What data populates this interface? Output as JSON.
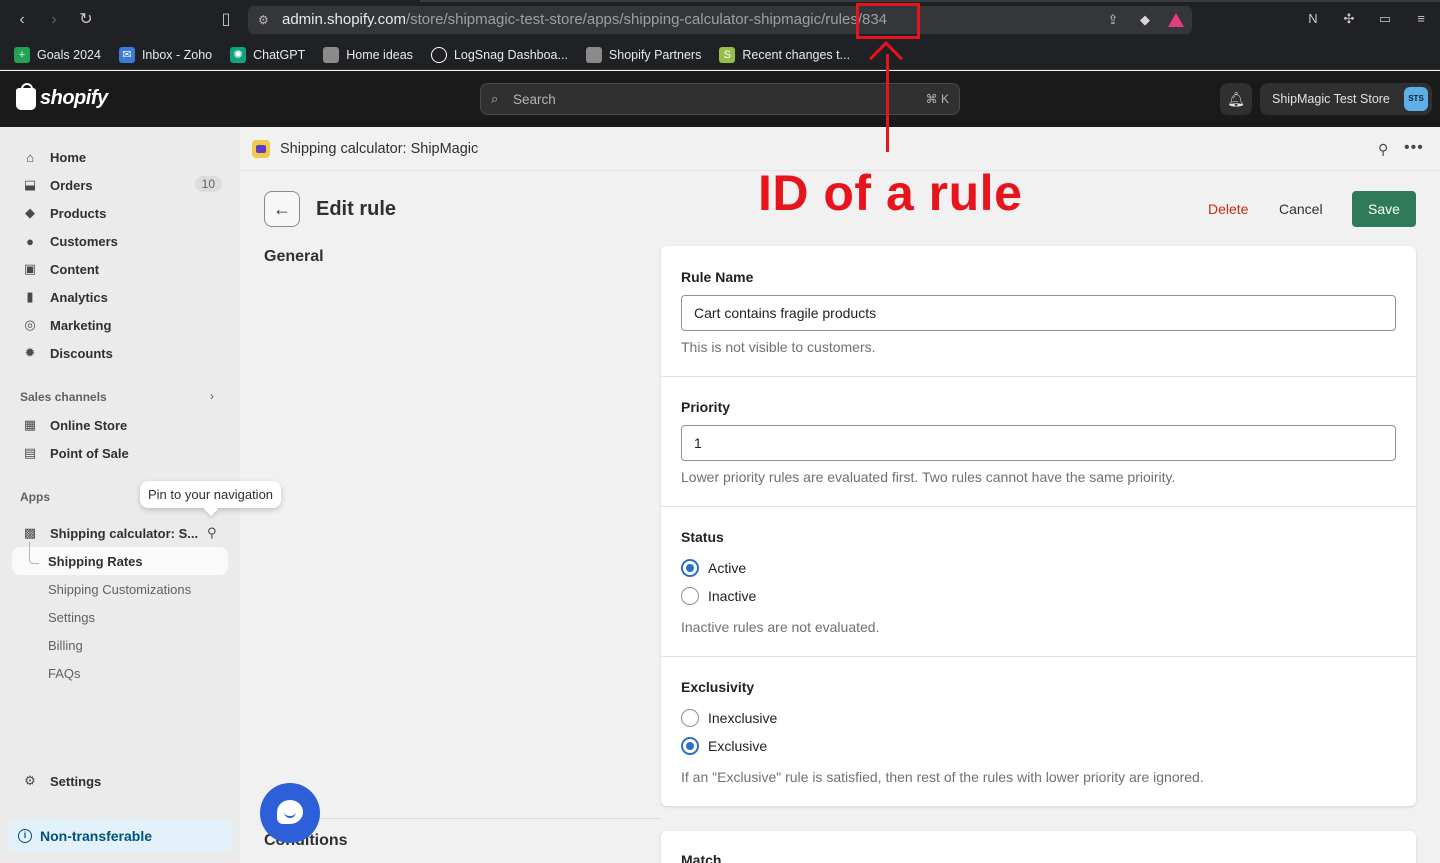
{
  "browser": {
    "url_host": "admin.shopify.com",
    "url_path": "/store/shipmagic-test-store/apps/shipping-calculator-shipmagic/rules/834",
    "bookmarks": [
      {
        "label": "Goals 2024",
        "icon": "plus-square-icon",
        "color": "#22a354"
      },
      {
        "label": "Inbox - Zoho",
        "icon": "mail-icon",
        "color": "#3b7bd6"
      },
      {
        "label": "ChatGPT",
        "icon": "chatgpt-icon",
        "color": "#10a37f"
      },
      {
        "label": "Home ideas",
        "icon": "folder-icon",
        "color": "#8a8a8a"
      },
      {
        "label": "LogSnag Dashboa...",
        "icon": "logsnag-icon",
        "color": "#ffffff"
      },
      {
        "label": "Shopify Partners",
        "icon": "folder-icon",
        "color": "#8a8a8a"
      },
      {
        "label": "Recent changes t...",
        "icon": "shopify-icon",
        "color": "#95bf47"
      }
    ]
  },
  "topbar": {
    "logo": "shopify",
    "search_placeholder": "Search",
    "search_shortcut": "⌘ K",
    "store_name": "ShipMagic Test Store",
    "store_avatar": "STS"
  },
  "sidebar": {
    "items": [
      {
        "label": "Home",
        "icon": "home-icon"
      },
      {
        "label": "Orders",
        "icon": "orders-icon",
        "badge": "10"
      },
      {
        "label": "Products",
        "icon": "tag-icon"
      },
      {
        "label": "Customers",
        "icon": "person-icon"
      },
      {
        "label": "Content",
        "icon": "content-icon"
      },
      {
        "label": "Analytics",
        "icon": "analytics-icon"
      },
      {
        "label": "Marketing",
        "icon": "marketing-icon"
      },
      {
        "label": "Discounts",
        "icon": "discount-icon"
      }
    ],
    "sales_channels_label": "Sales channels",
    "sales_channels": [
      {
        "label": "Online Store",
        "icon": "store-icon"
      },
      {
        "label": "Point of Sale",
        "icon": "pos-icon"
      }
    ],
    "apps_label": "Apps",
    "app_name": "Shipping calculator: S...",
    "pin_tooltip": "Pin to your navigation",
    "app_subitems": [
      "Shipping Rates",
      "Shipping Customizations",
      "Settings",
      "Billing",
      "FAQs"
    ],
    "settings_label": "Settings",
    "non_transferable": "Non-transferable"
  },
  "app_header": {
    "title": "Shipping calculator: ShipMagic"
  },
  "page": {
    "title": "Edit rule",
    "delete_label": "Delete",
    "cancel_label": "Cancel",
    "save_label": "Save",
    "general_heading": "General",
    "conditions_heading": "Conditions"
  },
  "form": {
    "rule_name_label": "Rule Name",
    "rule_name_value": "Cart contains fragile products",
    "rule_name_help": "This is not visible to customers.",
    "priority_label": "Priority",
    "priority_value": "1",
    "priority_help": "Lower priority rules are evaluated first. Two rules cannot have the same prioirity.",
    "status_label": "Status",
    "status_options": [
      "Active",
      "Inactive"
    ],
    "status_selected": "Active",
    "status_help": "Inactive rules are not evaluated.",
    "exclusivity_label": "Exclusivity",
    "exclusivity_options": [
      "Inexclusive",
      "Exclusive"
    ],
    "exclusivity_selected": "Exclusive",
    "exclusivity_help": "If an \"Exclusive\" rule is satisfied, then rest of the rules with lower priority are ignored.",
    "match_label": "Match"
  },
  "annotation": {
    "text": "ID of a rule",
    "color": "#e8141b"
  }
}
